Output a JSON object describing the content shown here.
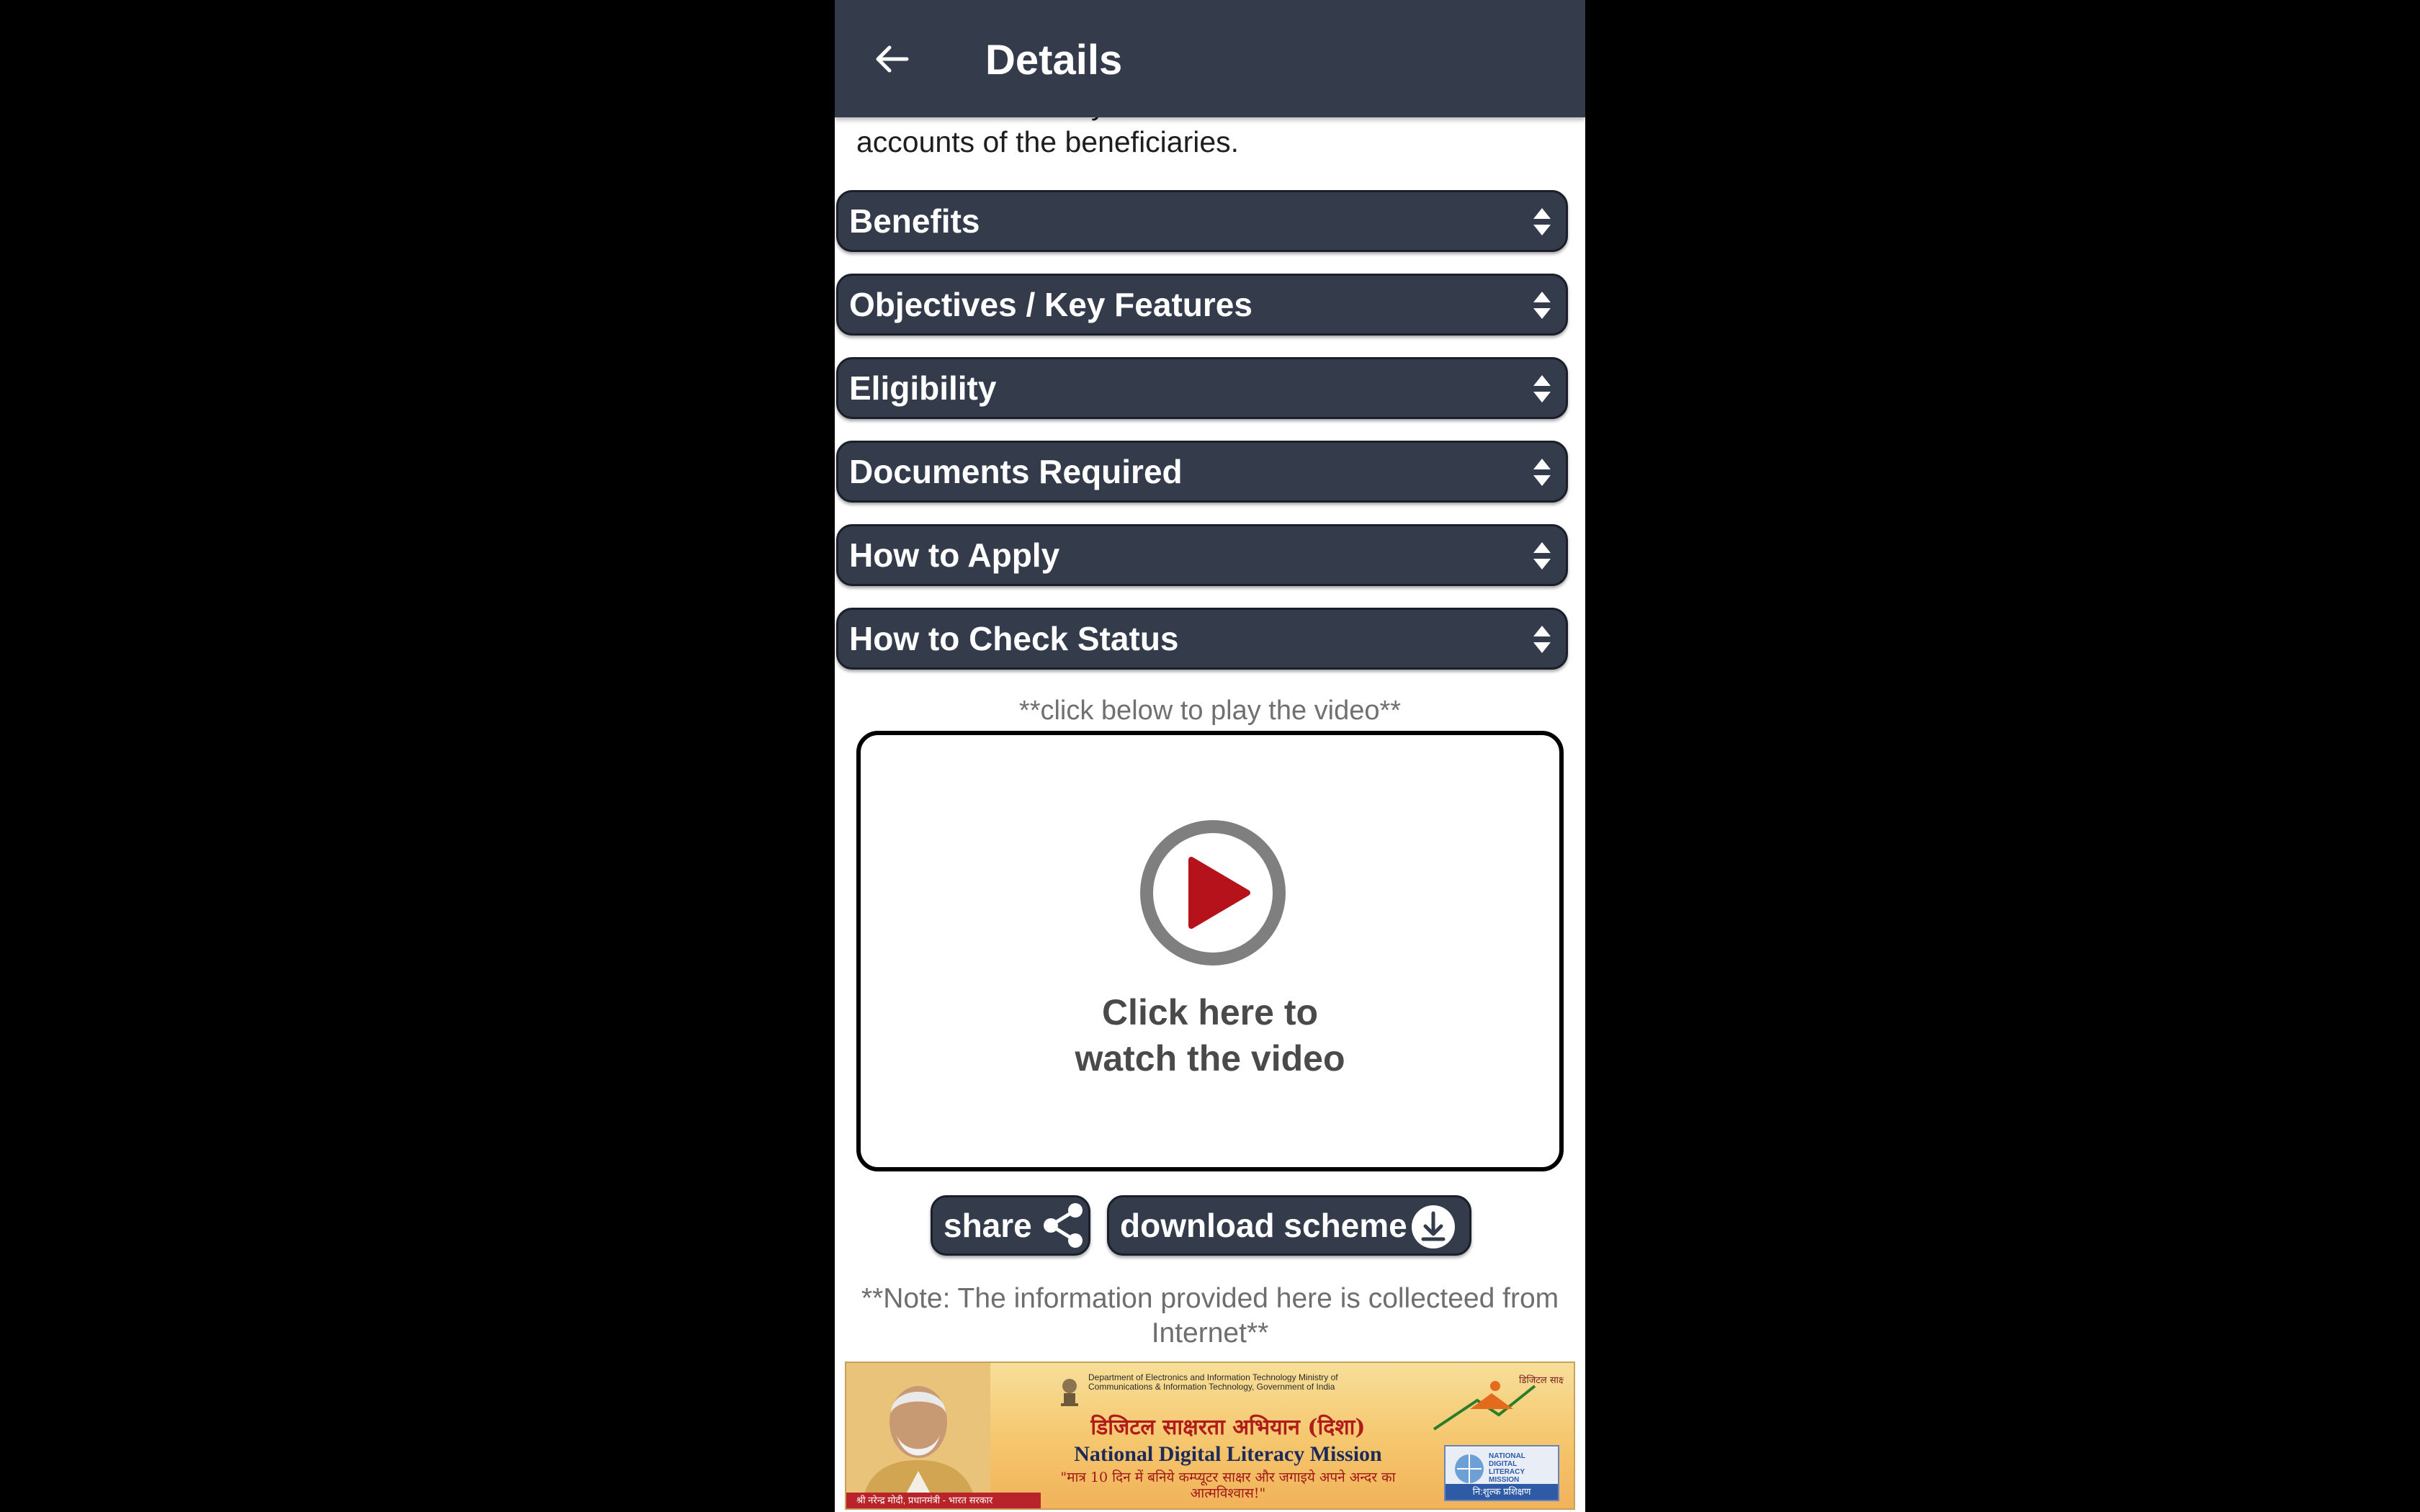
{
  "app_bar": {
    "title": "Details",
    "back_icon": "arrow-left-icon"
  },
  "intro": {
    "text": "amount will directly be transferred to the bank accounts of the beneficiaries."
  },
  "sections": [
    {
      "label": "Benefits"
    },
    {
      "label": "Objectives / Key Features"
    },
    {
      "label": "Eligibility"
    },
    {
      "label": "Documents Required"
    },
    {
      "label": "How to Apply"
    },
    {
      "label": "How to Check Status"
    }
  ],
  "video": {
    "hint": "**click below to play the video**",
    "caption_line1": "Click here to",
    "caption_line2": "watch the video"
  },
  "actions": {
    "share_label": "share",
    "download_label": "download scheme"
  },
  "note": "**Note: The information provided here is collecteed from Internet**",
  "banner": {
    "dept": "Department of Electronics and Information Technology Ministry of Communications & Information Technology, Government of India",
    "hindi_title": "डिजिटल साक्षरता अभियान (दिशा)",
    "english_title": "National Digital Literacy Mission",
    "tagline": "\"मात्र 10 दिन में बनिये कम्प्यूटर साक्षर और जगाइये अपने अन्दर का आत्मविश्वास!\"",
    "footer": "श्री नरेन्द्र मोदी, प्रधानमंत्री - भारत सरकार",
    "logo_text": "डिजिटल साक्षरता अभियान",
    "badge_top": "NATIONAL DIGITAL LITERACY MISSION",
    "badge_text": "नि:शुल्क प्रशिक्षण"
  },
  "colors": {
    "app_bar": "#343c4c",
    "accordion": "#343c4c",
    "play_red": "#b5121b",
    "play_ring": "#7f7f7f"
  }
}
